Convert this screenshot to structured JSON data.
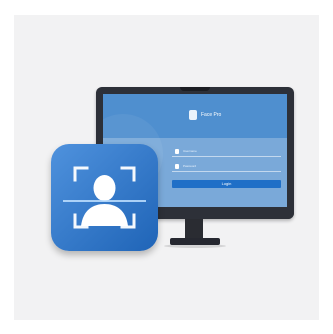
{
  "screen": {
    "app_title": "Face Pro",
    "username_placeholder": "Username",
    "password_placeholder": "Password",
    "login_label": "Login"
  },
  "icons": {
    "app_icon": "face-recognition-icon",
    "logo": "app-logo-icon",
    "user": "user-icon",
    "lock": "lock-icon"
  },
  "colors": {
    "accent": "#1f6fc7",
    "screen": "#7aa9d9",
    "header": "#4f8fcf",
    "icon_gradient_start": "#4f92dd",
    "icon_gradient_end": "#1f64b7",
    "bezel": "#2d3038"
  }
}
